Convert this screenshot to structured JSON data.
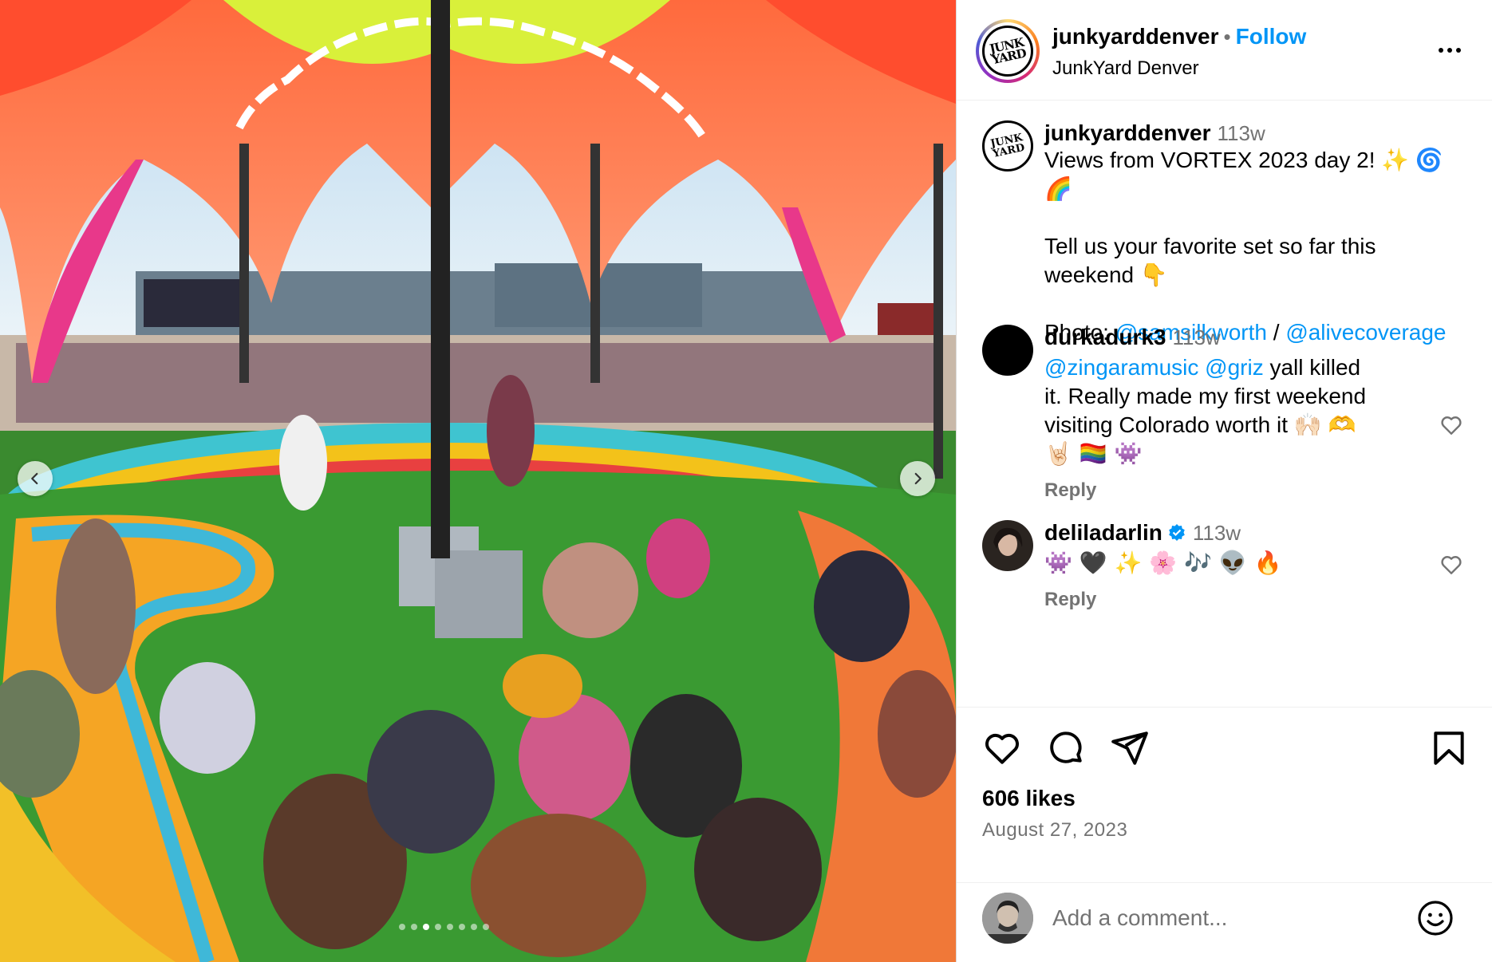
{
  "post": {
    "username": "junkyarddenver",
    "separator": "•",
    "follow_label": "Follow",
    "subtitle": "JunkYard Denver",
    "logo_text": "JUNK YARD",
    "image_description_icon": "festival-photo",
    "carousel": {
      "count": 8,
      "active_index": 2
    }
  },
  "caption": {
    "username": "junkyarddenver",
    "time": "113w",
    "line1": "Views from VORTEX 2023 day 2! ✨ 🌀",
    "line2": "🌈",
    "line3": "Tell us your favorite set so far this",
    "line4": "weekend 👇",
    "photo_label": "Photo:",
    "mention1": "@samsilkworth",
    "slash": "/",
    "mention2": "@alivecoverage"
  },
  "comments": [
    {
      "username": "durkadurk3",
      "time": "113w",
      "mention1": "@zingaramusic",
      "mention2": "@griz",
      "text1": "yall killed",
      "text2": "it. Really made my first weekend",
      "text3": "visiting Colorado worth it 🙌🏻 🫶",
      "text4": "🤘🏻 🏳️‍🌈 👾",
      "reply_label": "Reply"
    },
    {
      "username": "deliladarlin",
      "time": "113w",
      "text1": "👾 🖤 ✨ 🌸 🎶 👽 🔥",
      "reply_label": "Reply"
    }
  ],
  "actions": {
    "likes": "606 likes",
    "date": "August 27, 2023"
  },
  "comment_box": {
    "placeholder": "Add a comment..."
  }
}
